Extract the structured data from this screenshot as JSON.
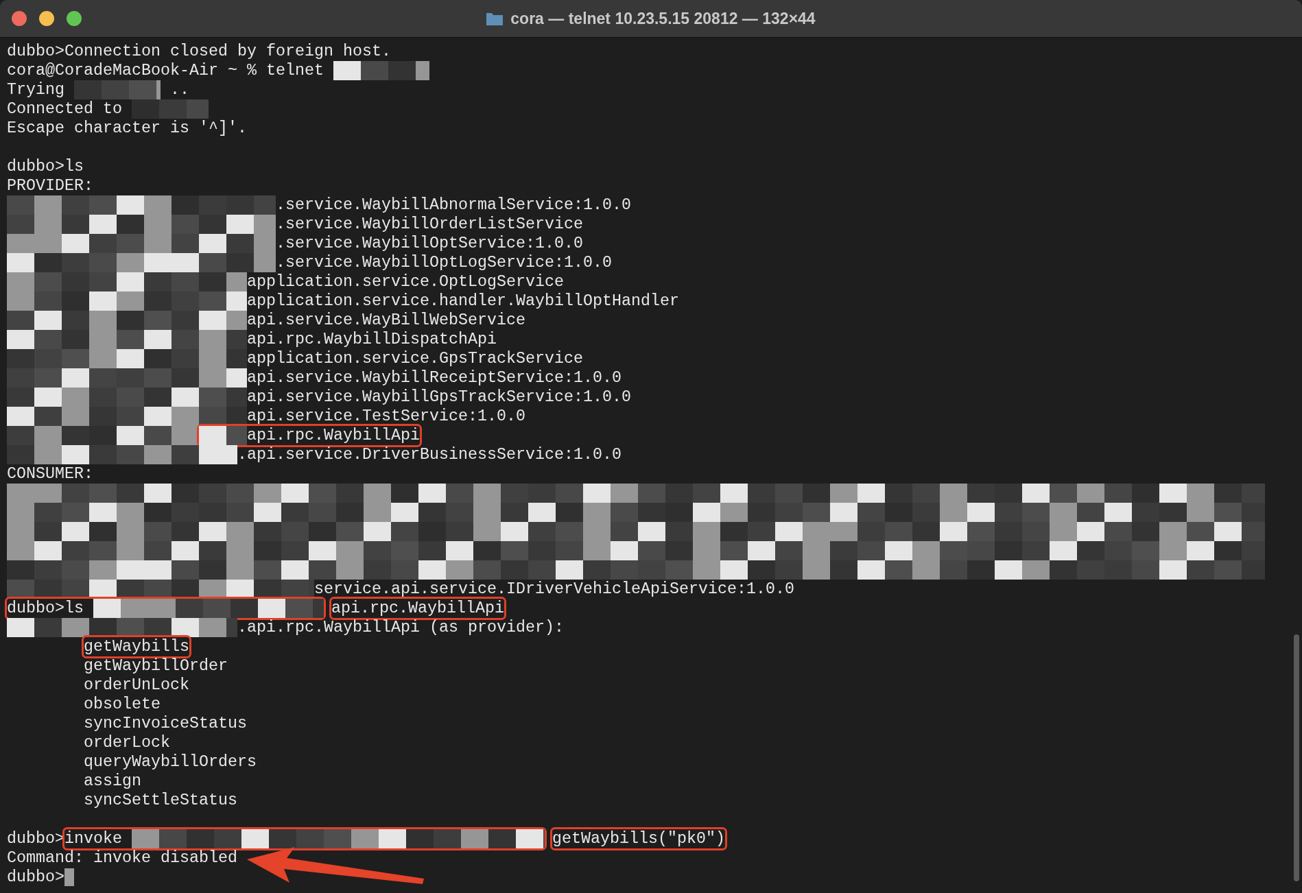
{
  "window": {
    "title": "cora — telnet 10.23.5.15 20812 — 132×44"
  },
  "terminal": {
    "lines": [
      {
        "kind": "plain",
        "segments": [
          {
            "kind": "text",
            "text": "dubbo>Connection closed by foreign host."
          }
        ]
      },
      {
        "kind": "plain",
        "segments": [
          {
            "kind": "text",
            "text": "cora@CoradeMacBook-Air ~ % telnet"
          },
          {
            "kind": "redacted"
          }
        ]
      },
      {
        "kind": "plain",
        "segments": [
          {
            "kind": "text",
            "text": "Trying"
          },
          {
            "kind": "redacted"
          },
          {
            "kind": "text",
            "text": ".."
          }
        ]
      },
      {
        "kind": "plain",
        "segments": [
          {
            "kind": "text",
            "text": "Connected to"
          },
          {
            "kind": "redacted"
          }
        ]
      },
      {
        "kind": "plain",
        "segments": [
          {
            "kind": "text",
            "text": "Escape character is '^]'."
          }
        ]
      },
      {
        "kind": "blank"
      },
      {
        "kind": "plain",
        "segments": [
          {
            "kind": "text",
            "text": "dubbo>ls"
          }
        ]
      },
      {
        "kind": "plain",
        "segments": [
          {
            "kind": "text",
            "text": "PROVIDER:"
          }
        ]
      },
      {
        "kind": "plain",
        "segments": [
          {
            "kind": "redacted"
          },
          {
            "kind": "text",
            "text": ".service.WaybillAbnormalService:1.0.0"
          }
        ]
      },
      {
        "kind": "plain",
        "segments": [
          {
            "kind": "redacted"
          },
          {
            "kind": "text",
            "text": ".service.WaybillOrderListService"
          }
        ]
      },
      {
        "kind": "plain",
        "segments": [
          {
            "kind": "redacted"
          },
          {
            "kind": "text",
            "text": ".service.WaybillOptService:1.0.0"
          }
        ]
      },
      {
        "kind": "plain",
        "segments": [
          {
            "kind": "redacted"
          },
          {
            "kind": "text",
            "text": ".service.WaybillOptLogService:1.0.0"
          }
        ]
      },
      {
        "kind": "plain",
        "segments": [
          {
            "kind": "redacted"
          },
          {
            "kind": "text",
            "text": "application.service.OptLogService"
          }
        ]
      },
      {
        "kind": "plain",
        "segments": [
          {
            "kind": "redacted"
          },
          {
            "kind": "text",
            "text": "application.service.handler.WaybillOptHandler"
          }
        ]
      },
      {
        "kind": "plain",
        "segments": [
          {
            "kind": "redacted"
          },
          {
            "kind": "text",
            "text": "api.service.WayBillWebService"
          }
        ]
      },
      {
        "kind": "plain",
        "segments": [
          {
            "kind": "redacted"
          },
          {
            "kind": "text",
            "text": "api.rpc.WaybillDispatchApi"
          }
        ]
      },
      {
        "kind": "plain",
        "segments": [
          {
            "kind": "redacted"
          },
          {
            "kind": "text",
            "text": "application.service.GpsTrackService"
          }
        ]
      },
      {
        "kind": "plain",
        "segments": [
          {
            "kind": "redacted"
          },
          {
            "kind": "text",
            "text": "api.service.WaybillReceiptService:1.0.0"
          }
        ]
      },
      {
        "kind": "plain",
        "segments": [
          {
            "kind": "redacted"
          },
          {
            "kind": "text",
            "text": "api.service.WaybillGpsTrackService:1.0.0"
          }
        ]
      },
      {
        "kind": "plain",
        "segments": [
          {
            "kind": "redacted"
          },
          {
            "kind": "text",
            "text": "api.service.TestService:1.0.0"
          }
        ]
      },
      {
        "kind": "plain",
        "segments": [
          {
            "kind": "redacted"
          },
          {
            "kind": "box",
            "parts": [
              {
                "kind": "redacted"
              },
              {
                "kind": "text",
                "text": "api.rpc.WaybillApi"
              }
            ]
          }
        ]
      },
      {
        "kind": "plain",
        "segments": [
          {
            "kind": "redacted"
          },
          {
            "kind": "text",
            "text": ".api.service.DriverBusinessService:1.0.0"
          }
        ]
      },
      {
        "kind": "plain",
        "segments": [
          {
            "kind": "text",
            "text": "CONSUMER:"
          }
        ]
      },
      {
        "kind": "plain",
        "segments": [
          {
            "kind": "redacted"
          }
        ]
      },
      {
        "kind": "plain",
        "segments": [
          {
            "kind": "redacted"
          }
        ]
      },
      {
        "kind": "plain",
        "segments": [
          {
            "kind": "redacted"
          }
        ]
      },
      {
        "kind": "plain",
        "segments": [
          {
            "kind": "redacted"
          }
        ]
      },
      {
        "kind": "plain",
        "segments": [
          {
            "kind": "redacted"
          }
        ]
      },
      {
        "kind": "plain",
        "segments": [
          {
            "kind": "redacted"
          },
          {
            "kind": "text",
            "text": "service.api.service.IDriverVehicleApiService:1.0.0"
          }
        ]
      },
      {
        "kind": "plain",
        "segments": [
          {
            "kind": "box",
            "parts": [
              {
                "kind": "text",
                "text": "dubbo>ls"
              },
              {
                "kind": "redacted"
              }
            ]
          },
          {
            "kind": "box",
            "parts": [
              {
                "kind": "text",
                "text": "api.rpc.WaybillApi"
              }
            ]
          }
        ]
      },
      {
        "kind": "plain",
        "segments": [
          {
            "kind": "redacted"
          },
          {
            "kind": "text",
            "text": ".api.rpc.WaybillApi (as provider):"
          }
        ]
      },
      {
        "kind": "method",
        "segments": [
          {
            "kind": "box",
            "parts": [
              {
                "kind": "text",
                "text": "getWaybills"
              }
            ]
          }
        ]
      },
      {
        "kind": "method",
        "segments": [
          {
            "kind": "text",
            "text": "getWaybillOrder"
          }
        ]
      },
      {
        "kind": "method",
        "segments": [
          {
            "kind": "text",
            "text": "orderUnLock"
          }
        ]
      },
      {
        "kind": "method",
        "segments": [
          {
            "kind": "text",
            "text": "obsolete"
          }
        ]
      },
      {
        "kind": "method",
        "segments": [
          {
            "kind": "text",
            "text": "syncInvoiceStatus"
          }
        ]
      },
      {
        "kind": "method",
        "segments": [
          {
            "kind": "text",
            "text": "orderLock"
          }
        ]
      },
      {
        "kind": "method",
        "segments": [
          {
            "kind": "text",
            "text": "queryWaybillOrders"
          }
        ]
      },
      {
        "kind": "method",
        "segments": [
          {
            "kind": "text",
            "text": "assign"
          }
        ]
      },
      {
        "kind": "method",
        "segments": [
          {
            "kind": "text",
            "text": "syncSettleStatus"
          }
        ]
      },
      {
        "kind": "blank"
      },
      {
        "kind": "plain",
        "segments": [
          {
            "kind": "text",
            "text": "dubbo>"
          },
          {
            "kind": "box",
            "parts": [
              {
                "kind": "text",
                "text": "invoke"
              },
              {
                "kind": "redacted"
              }
            ]
          },
          {
            "kind": "box",
            "parts": [
              {
                "kind": "text",
                "text": "getWaybills(\"pk0\")"
              }
            ]
          }
        ]
      },
      {
        "kind": "plain",
        "segments": [
          {
            "kind": "text",
            "text": "Command: invoke disabled"
          }
        ]
      },
      {
        "kind": "plain",
        "segments": [
          {
            "kind": "text",
            "text": "dubbo>"
          },
          {
            "kind": "cursor"
          }
        ]
      }
    ]
  }
}
